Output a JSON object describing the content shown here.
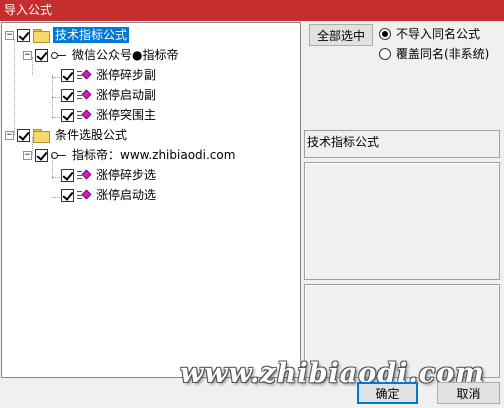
{
  "window": {
    "title": "导入公式"
  },
  "tree": {
    "groups": [
      {
        "label": "技术指标公式",
        "selected": true,
        "sub": {
          "label": "微信公众号●指标帝",
          "items": [
            "涨停碎步副",
            "涨停启动副",
            "涨停突围主"
          ]
        }
      },
      {
        "label": "条件选股公式",
        "selected": false,
        "sub": {
          "label": "指标帝：www.zhibiaodi.com",
          "items": [
            "涨停碎步选",
            "涨停启动选"
          ]
        }
      }
    ]
  },
  "options": {
    "select_all_label": "全部选中",
    "radio_no_import": "不导入同名公式",
    "radio_overwrite": "覆盖同名(非系统)"
  },
  "info": {
    "category_label": "技术指标公式"
  },
  "footer": {
    "ok_label": "确定",
    "cancel_label": "取消",
    "watermark": "www.zhibiaodi.com"
  },
  "colors": {
    "titlebar": "#c52e2e",
    "selection": "#0078d7",
    "gem": "#d81bd0"
  }
}
